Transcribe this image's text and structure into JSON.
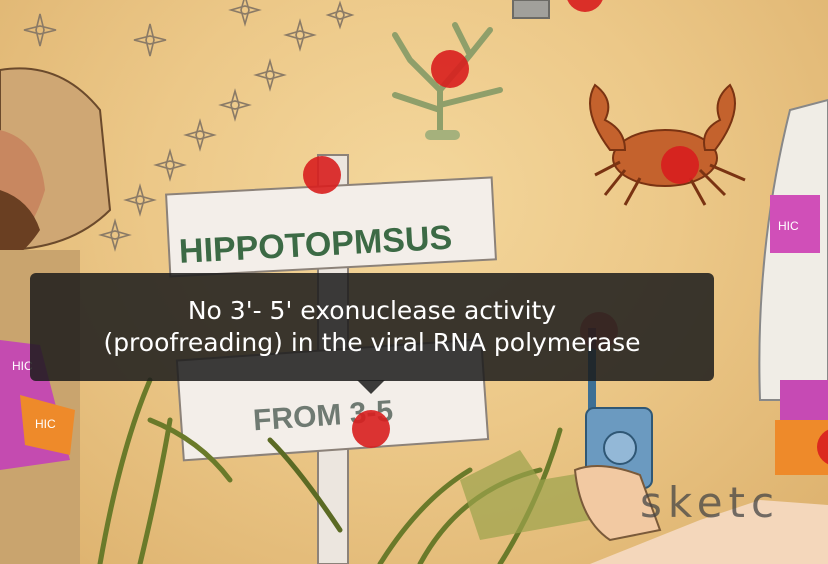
{
  "scene": {
    "sign_top_text": "HIPPOTOPMSUS",
    "sign_bottom_partial_text": "FROM 3-5",
    "watermark": "sketc",
    "box_label_1": "HIC",
    "box_label_2": "HIC",
    "box_label_3": "HIC"
  },
  "tooltip": {
    "line1": "No 3'- 5' exonuclease activity",
    "line2": "(proofreading) in the viral RNA polymerase"
  },
  "colors": {
    "sand": "#ecc888",
    "hotspot": "#d81e1e",
    "tooltip_bg": "#1c1c1c",
    "sign_text_green": "#3c6a45",
    "crab": "#c4622d"
  },
  "hotspots": [
    {
      "label": "coral hotspot"
    },
    {
      "label": "crab hotspot"
    },
    {
      "label": "sign hotspot"
    },
    {
      "label": "walkie-talkie hotspot"
    },
    {
      "label": "sign bottom hotspot"
    },
    {
      "label": "right edge hotspot"
    },
    {
      "label": "top hotspot"
    }
  ]
}
